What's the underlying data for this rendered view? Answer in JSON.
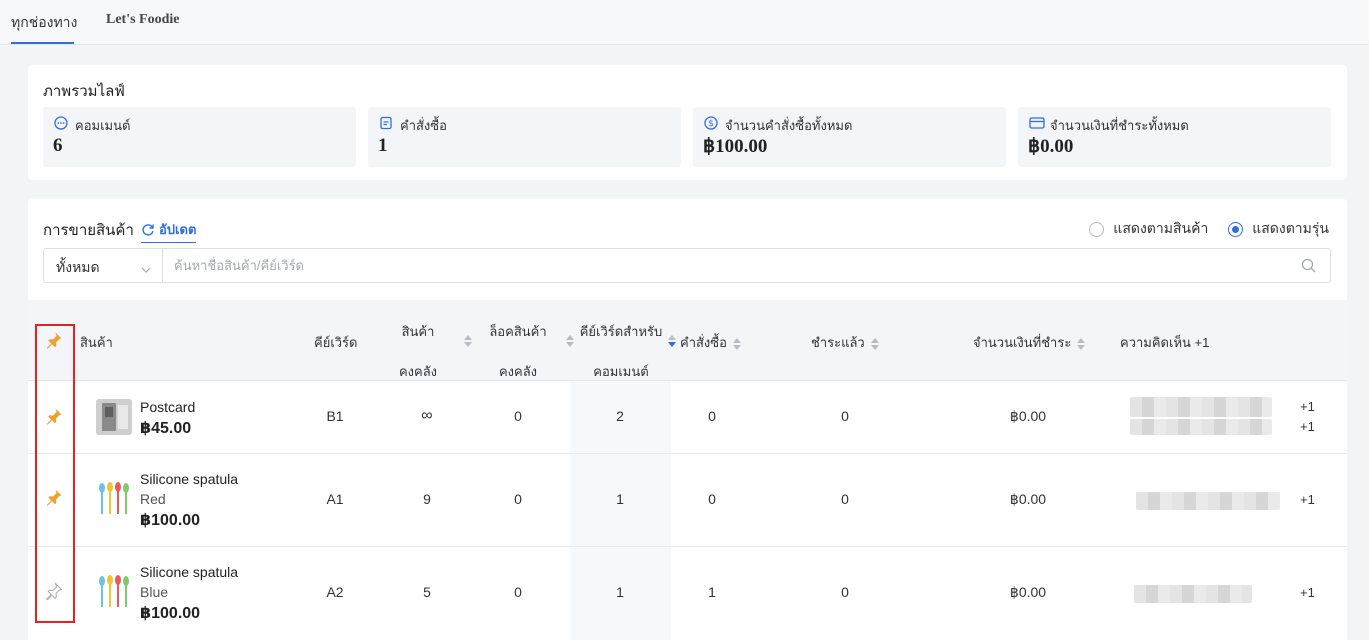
{
  "tabs": [
    {
      "label": "ทุกช่องทาง",
      "active": true
    },
    {
      "label": "Let's Foodie",
      "active": false
    }
  ],
  "overview": {
    "title": "ภาพรวมไลฟ์",
    "stats": [
      {
        "icon": "comment-icon",
        "label": "คอมเมนต์",
        "value": "6"
      },
      {
        "icon": "order-icon",
        "label": "คำสั่งซื้อ",
        "value": "1"
      },
      {
        "icon": "dollar-icon",
        "label": "จำนวนคำสั่งซื้อทั้งหมด",
        "value": "฿100.00"
      },
      {
        "icon": "card-icon",
        "label": "จำนวนเงินที่ชำระทั้งหมด",
        "value": "฿0.00"
      }
    ]
  },
  "sales": {
    "title": "การขายสินค้า",
    "update_label": "อัปเดต",
    "view_options": [
      {
        "label": "แสดงตามสินค้า",
        "selected": false
      },
      {
        "label": "แสดงตามรุ่น",
        "selected": true
      }
    ],
    "filter_value": "ทั้งหมด",
    "search_placeholder": "ค้นหาชื่อสินค้า/คีย์เวิร์ด"
  },
  "table": {
    "headers": {
      "product": "สินค้า",
      "keyword": "คีย์เวิร์ด",
      "stock_1": "สินค้า",
      "stock_2": "คงคลัง",
      "locked_1": "ล็อคสินค้า",
      "locked_2": "คงคลัง",
      "kwc_1": "คีย์เวิร์ดสำหรับ",
      "kwc_2": "คอมเมนต์",
      "orders": "คำสั่งซื้อ",
      "paid": "ชำระแล้ว",
      "amount": "จำนวนเงินที่ชำระ",
      "comments": "ความคิดเห็น +1"
    },
    "rows": [
      {
        "pinned": true,
        "name": "Postcard",
        "variant": "",
        "price": "฿45.00",
        "keyword": "B1",
        "stock": "∞",
        "locked": "0",
        "kw_comment": "2",
        "orders": "0",
        "paid": "0",
        "amount": "฿0.00",
        "plus": [
          "+1",
          "+1"
        ],
        "thumb": "postcard"
      },
      {
        "pinned": true,
        "name": "Silicone spatula",
        "variant": "Red",
        "price": "฿100.00",
        "keyword": "A1",
        "stock": "9",
        "locked": "0",
        "kw_comment": "1",
        "orders": "0",
        "paid": "0",
        "amount": "฿0.00",
        "plus": [
          "+1"
        ],
        "thumb": "spatula"
      },
      {
        "pinned": false,
        "name": "Silicone spatula",
        "variant": "Blue",
        "price": "฿100.00",
        "keyword": "A2",
        "stock": "5",
        "locked": "0",
        "kw_comment": "1",
        "orders": "1",
        "paid": "0",
        "amount": "฿0.00",
        "plus": [
          "+1"
        ],
        "thumb": "spatula"
      }
    ]
  },
  "colors": {
    "accent": "#2f6fdd",
    "pin_active": "#f0a030",
    "highlight_box": "#e02424"
  }
}
